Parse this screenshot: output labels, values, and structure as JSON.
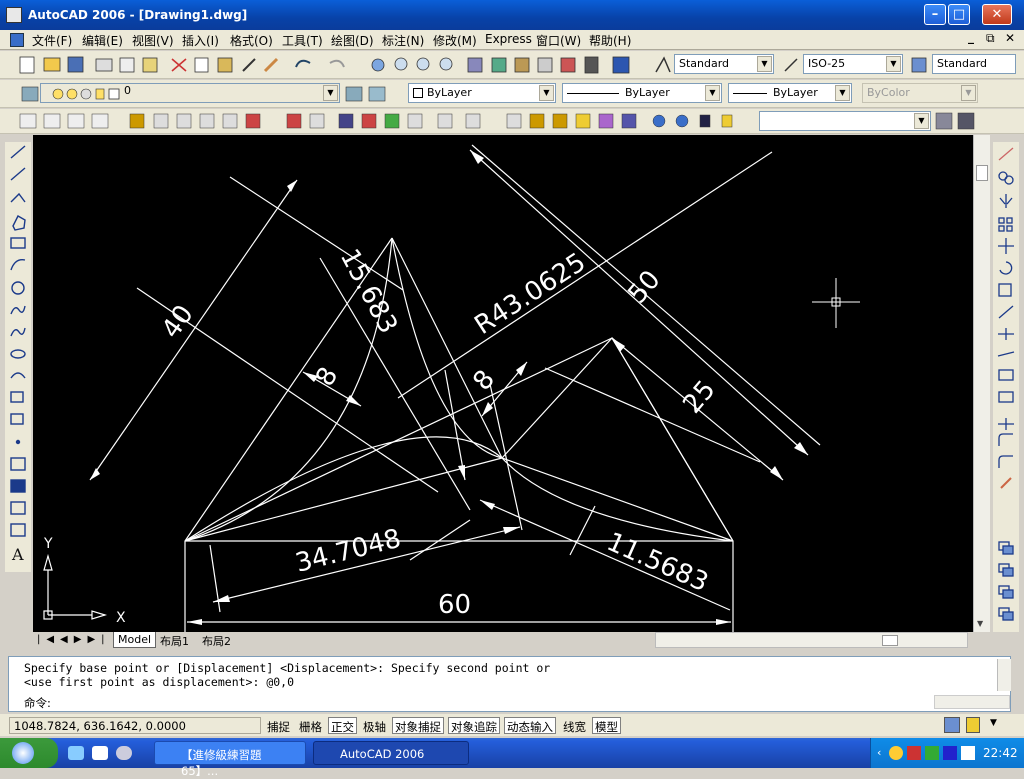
{
  "window": {
    "title": "AutoCAD 2006 - [Drawing1.dwg]",
    "min": "–",
    "max": "□",
    "close": "✕",
    "doc_min": "_",
    "doc_restore": "⧉",
    "doc_close": "✕"
  },
  "menu": [
    "文件(F)",
    "编辑(E)",
    "视图(V)",
    "插入(I)",
    "格式(O)",
    "工具(T)",
    "绘图(D)",
    "标注(N)",
    "修改(M)",
    "Express",
    "窗口(W)",
    "帮助(H)"
  ],
  "styles": {
    "text_style": "Standard",
    "dim_style": "ISO-25",
    "table_style": "Standard"
  },
  "layers": {
    "current_layer": "0",
    "color": "ByLayer",
    "linetype": "ByLayer",
    "lineweight": "ByLayer",
    "plotstyle": "ByColor"
  },
  "drawing": {
    "dims": {
      "d40": "40",
      "d15683_top": "15.683",
      "r43": "R43.0625",
      "d50": "50",
      "d8_left": "8",
      "d8_right": "8",
      "d25": "25",
      "d34": "34.7048",
      "d11": "11.5683",
      "d60": "60"
    },
    "ucs": {
      "y": "Y",
      "x": "X"
    }
  },
  "tabs": [
    "Model",
    "布局1",
    "布局2"
  ],
  "command": {
    "line1": "Specify base point or [Displacement] <Displacement>: Specify second point or",
    "line2": "<use first point as displacement>: @0,0",
    "prompt": "命令:"
  },
  "status": {
    "coords": "1048.7824, 636.1642, 0.0000",
    "buttons": [
      "捕捉",
      "栅格",
      "正交",
      "极轴",
      "对象捕捉",
      "对象追踪",
      "动态输入",
      "线宽",
      "模型"
    ]
  },
  "taskbar": {
    "task1": "【進修級練習題65】...",
    "task2": "AutoCAD 2006",
    "clock": "22:42"
  },
  "colors": {
    "canvas": "#000000",
    "lines": "#ffffff",
    "titlebar": "#0a5fd8"
  }
}
